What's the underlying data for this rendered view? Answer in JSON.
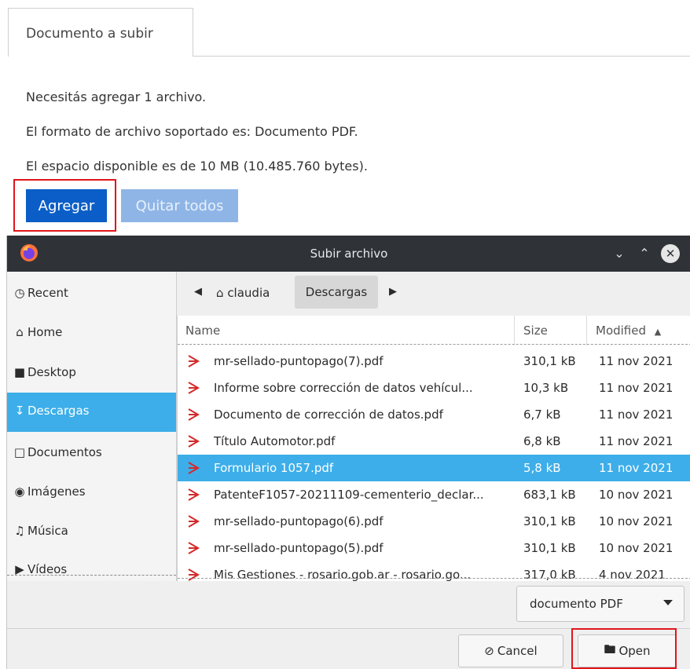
{
  "web": {
    "tab_label": "Documento a subir",
    "line1": "Necesitás agregar 1 archivo.",
    "line2": "El formato de archivo soportado es: Documento PDF.",
    "line3": "El espacio disponible es de 10 MB (10.485.760 bytes).",
    "add_button": "Agregar",
    "remove_all_button": "Quitar todos"
  },
  "dialog": {
    "title": "Subir archivo",
    "sidebar": [
      {
        "icon": "clock-icon",
        "label": "Recent"
      },
      {
        "icon": "home-icon",
        "label": "Home"
      },
      {
        "icon": "folder-icon",
        "label": "Desktop"
      },
      {
        "icon": "download-icon",
        "label": "Descargas",
        "active": true
      },
      {
        "icon": "document-icon",
        "label": "Documentos"
      },
      {
        "icon": "camera-icon",
        "label": "Imágenes"
      },
      {
        "icon": "music-icon",
        "label": "Música"
      },
      {
        "icon": "video-icon",
        "label": "Vídeos"
      }
    ],
    "breadcrumb": {
      "home": "claudia",
      "current": "Descargas"
    },
    "columns": {
      "name": "Name",
      "size": "Size",
      "modified": "Modified"
    },
    "files": [
      {
        "name": "mr-sellado-puntopago(7).pdf",
        "size": "310,1 kB",
        "modified": "11 nov 2021"
      },
      {
        "name": "Informe sobre corrección de datos vehícul...",
        "size": "10,3 kB",
        "modified": "11 nov 2021"
      },
      {
        "name": "Documento de corrección de datos.pdf",
        "size": "6,7 kB",
        "modified": "11 nov 2021"
      },
      {
        "name": "Título Automotor.pdf",
        "size": "6,8 kB",
        "modified": "11 nov 2021"
      },
      {
        "name": "Formulario 1057.pdf",
        "size": "5,8 kB",
        "modified": "11 nov 2021",
        "selected": true
      },
      {
        "name": "PatenteF1057-20211109-cementerio_declar...",
        "size": "683,1 kB",
        "modified": "10 nov 2021"
      },
      {
        "name": "mr-sellado-puntopago(6).pdf",
        "size": "310,1 kB",
        "modified": "10 nov 2021"
      },
      {
        "name": "mr-sellado-puntopago(5).pdf",
        "size": "310,1 kB",
        "modified": "10 nov 2021"
      },
      {
        "name": "Mis Gestiones - rosario.gob.ar - rosario.go...",
        "size": "317,0 kB",
        "modified": "4 nov 2021"
      }
    ],
    "filter": "documento PDF",
    "cancel_button": "Cancel",
    "open_button": "Open"
  },
  "colors": {
    "accent": "#3daee9",
    "primary_button": "#0b5ec7",
    "highlight_red": "#e0151b",
    "pdf_icon": "#d42a2a"
  }
}
